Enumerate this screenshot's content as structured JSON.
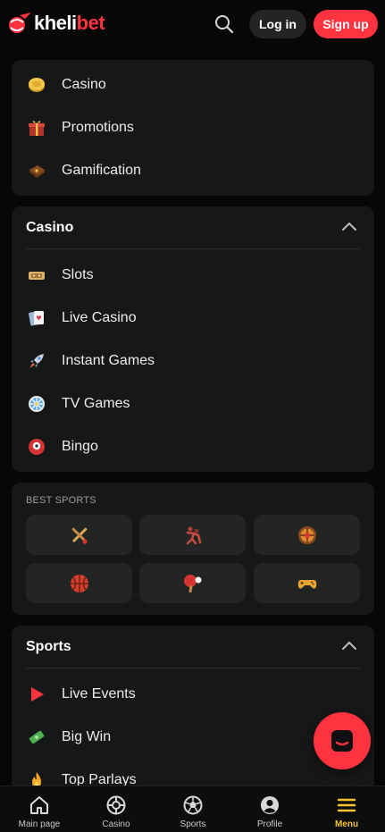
{
  "header": {
    "brand_white": "kheli",
    "brand_red": "bet",
    "login_label": "Log in",
    "signup_label": "Sign up"
  },
  "top_menu": [
    {
      "label": "Casino",
      "icon": "gold-coin-icon"
    },
    {
      "label": "Promotions",
      "icon": "gift-box-icon"
    },
    {
      "label": "Gamification",
      "icon": "treasure-chest-icon"
    }
  ],
  "casino_section": {
    "title": "Casino",
    "items": [
      {
        "label": "Slots",
        "icon": "slot-ticket-icon"
      },
      {
        "label": "Live Casino",
        "icon": "playing-cards-icon"
      },
      {
        "label": "Instant Games",
        "icon": "rocket-icon"
      },
      {
        "label": "TV Games",
        "icon": "wheel-icon"
      },
      {
        "label": "Bingo",
        "icon": "bingo-ball-icon"
      }
    ]
  },
  "best_sports": {
    "label": "BEST SPORTS",
    "tiles": [
      "cricket-icon",
      "wrestling-icon",
      "basketball-emblem-icon",
      "basketball-icon",
      "table-tennis-icon",
      "gamepad-icon"
    ]
  },
  "sports_section": {
    "title": "Sports",
    "items": [
      {
        "label": "Live Events",
        "icon": "play-triangle-icon"
      },
      {
        "label": "Big Win",
        "icon": "money-icon"
      },
      {
        "label": "Top Parlays",
        "icon": "fire-icon"
      }
    ]
  },
  "bottom_nav": [
    {
      "label": "Main page",
      "icon": "home-icon"
    },
    {
      "label": "Casino",
      "icon": "roulette-icon"
    },
    {
      "label": "Sports",
      "icon": "soccer-ball-icon"
    },
    {
      "label": "Profile",
      "icon": "profile-icon"
    },
    {
      "label": "Menu",
      "icon": "hamburger-icon",
      "active": true
    }
  ],
  "colors": {
    "accent_red": "#ff3340",
    "accent_yellow": "#f8c42b",
    "background": "#060706",
    "card": "#161818"
  }
}
